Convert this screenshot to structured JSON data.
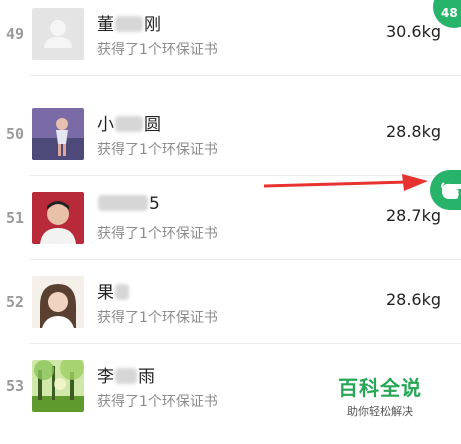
{
  "top_badge": {
    "text": "48"
  },
  "rows": [
    {
      "rank": "49",
      "name_prefix": "董",
      "name_suffix": "刚",
      "subtitle": "获得了1个环保证书",
      "weight": "30.6kg"
    },
    {
      "rank": "50",
      "name_prefix": "小",
      "name_suffix": "圆",
      "subtitle": "获得了1个环保证书",
      "weight": "28.8kg"
    },
    {
      "rank": "51",
      "name_prefix": "",
      "name_suffix": "5",
      "subtitle": "获得了1个环保证书",
      "weight": "28.7kg"
    },
    {
      "rank": "52",
      "name_prefix": "果",
      "name_suffix": "",
      "subtitle": "获得了1个环保证书",
      "weight": "28.6kg"
    },
    {
      "rank": "53",
      "name_prefix": "李",
      "name_suffix": "雨",
      "subtitle": "获得了1个环保证书",
      "weight": ""
    }
  ],
  "overlay": {
    "arrow_color": "#e8322f",
    "hand_icon": "hand-icon",
    "accent_color": "#27b36a"
  },
  "watermark": {
    "title": "百科全说",
    "subtitle": "助你轻松解决"
  }
}
